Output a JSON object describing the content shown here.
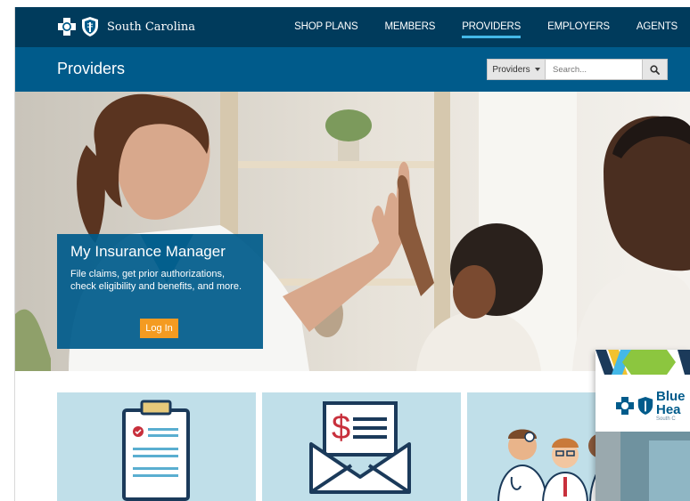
{
  "brand": {
    "name": "South Carolina"
  },
  "nav": {
    "links": [
      {
        "label": "SHOP PLANS",
        "active": false
      },
      {
        "label": "MEMBERS",
        "active": false
      },
      {
        "label": "PROVIDERS",
        "active": true
      },
      {
        "label": "EMPLOYERS",
        "active": false
      },
      {
        "label": "AGENTS",
        "active": false
      }
    ]
  },
  "subheader": {
    "title": "Providers",
    "search": {
      "scope": "Providers",
      "placeholder": "Search..."
    }
  },
  "hero": {
    "promo_title": "My Insurance Manager",
    "promo_text": "File claims, get prior authorizations, check eligibility and benefits, and more.",
    "login_label": "Log In"
  },
  "popup": {
    "brand_line1": "Blue",
    "brand_line2": "Hea",
    "brand_sub": "South C"
  },
  "colors": {
    "nav_bg": "#003b5c",
    "subbar_bg": "#005b8b",
    "accent_underline": "#44b8e8",
    "cta": "#f49b21",
    "card_bg": "#c0dfe9"
  },
  "icons": [
    "blue-cross-icon",
    "blue-shield-icon",
    "search-icon",
    "clipboard-icon",
    "envelope-dollar-icon",
    "doctors-icon"
  ]
}
